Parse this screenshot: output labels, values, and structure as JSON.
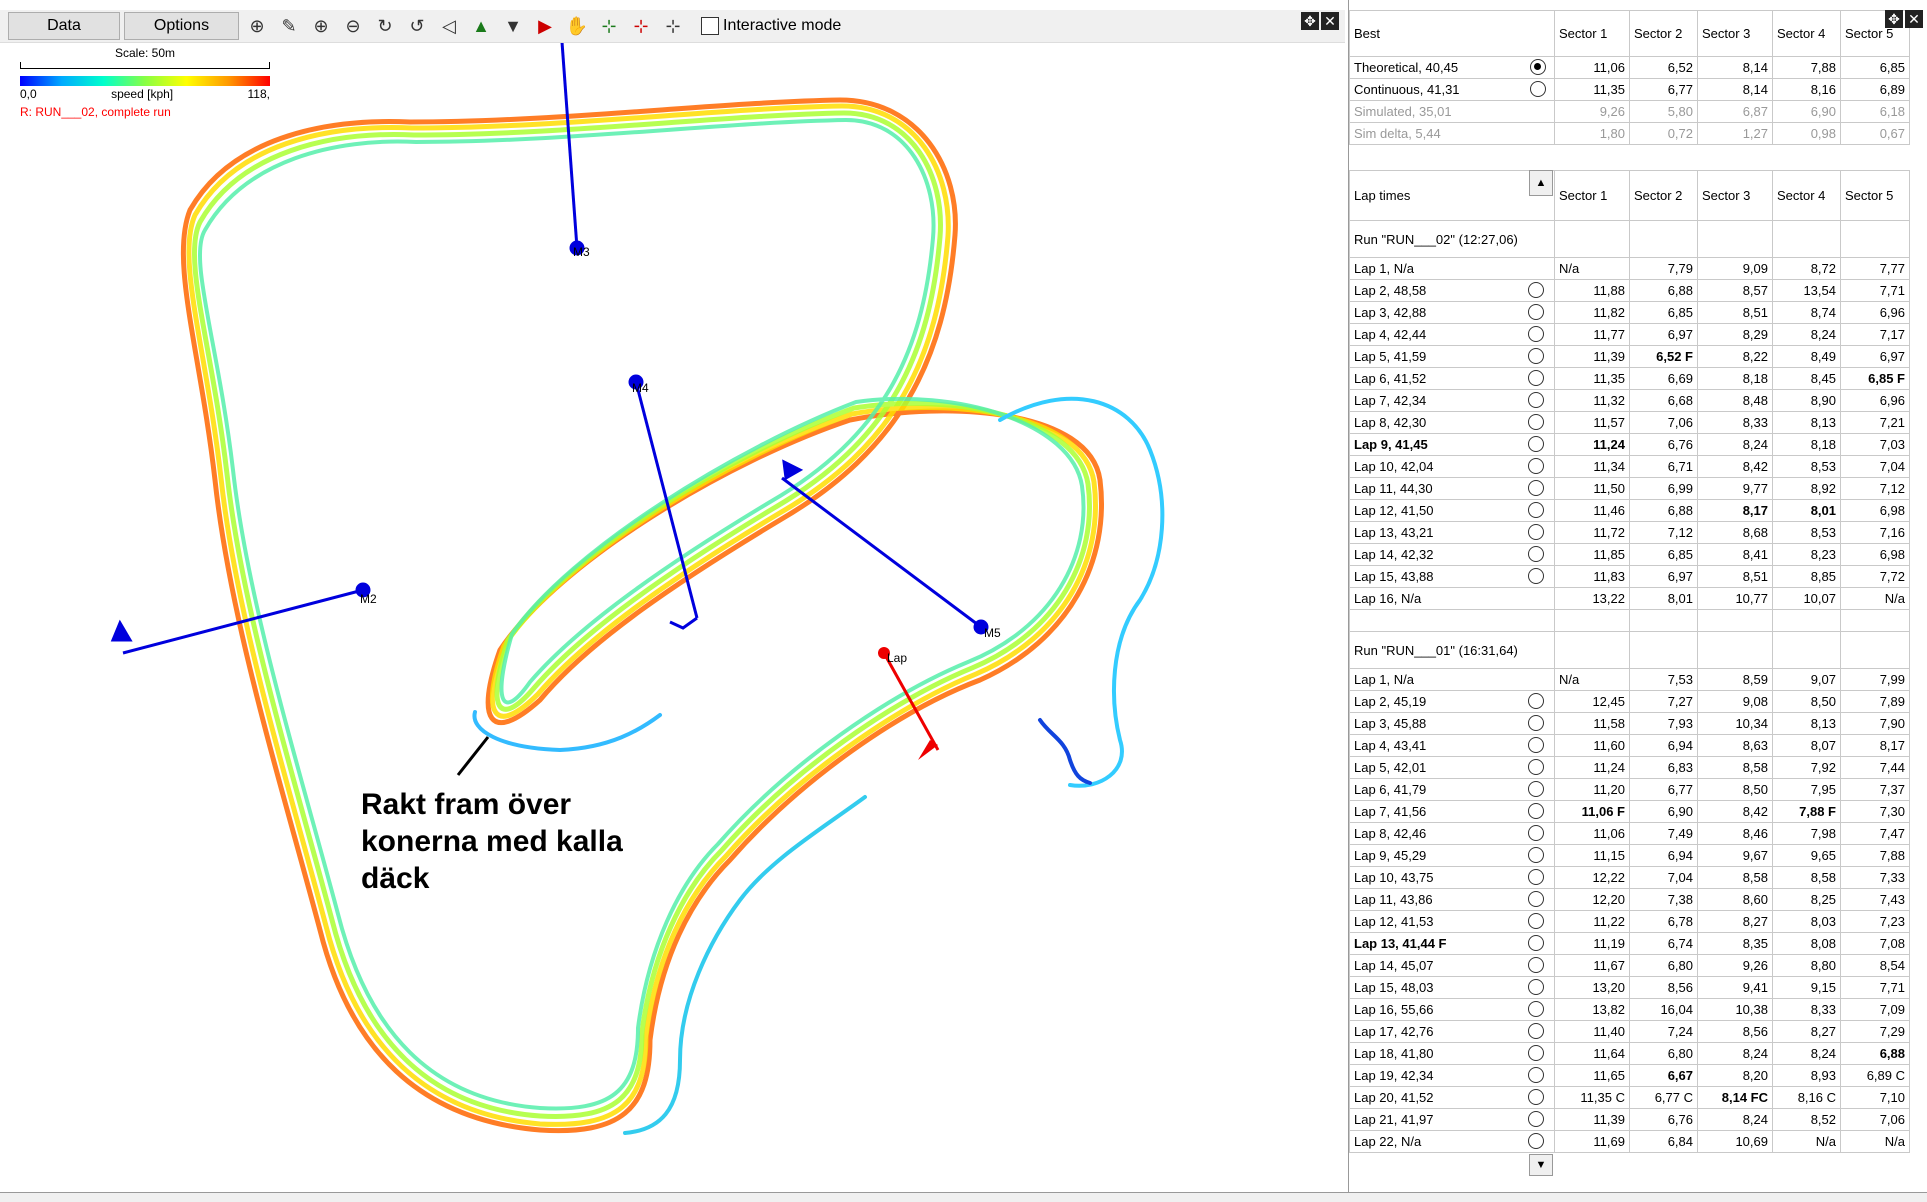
{
  "toolbar": {
    "data_label": "Data",
    "options_label": "Options",
    "interactive_label": "Interactive mode",
    "icons": [
      "zoom-fit-icon",
      "edit-icon",
      "zoom-in-icon",
      "zoom-out-icon",
      "rotate-cw-icon",
      "rotate-ccw-icon",
      "prev-marker-icon",
      "start-marker-icon",
      "split-marker-icon",
      "end-marker-icon",
      "pan-hand-icon",
      "add-point-icon",
      "remove-point-icon",
      "reset-points-icon"
    ]
  },
  "map": {
    "scale_label": "Scale: 50m",
    "speed_min": "0,0",
    "speed_label": "speed [kph]",
    "speed_max": "118,",
    "run_label": "R:  RUN___02, complete run",
    "markers": [
      "M2",
      "M3",
      "M4",
      "M5",
      "Lap"
    ],
    "annotation": "Rakt fram över konerna med kalla däck"
  },
  "best": {
    "headers": [
      "Best",
      "Sector 1",
      "Sector 2",
      "Sector 3",
      "Sector 4",
      "Sector 5"
    ],
    "rows": [
      {
        "label": "Theoretical,  40,45",
        "radio": "on",
        "vals": [
          "11,06",
          "6,52",
          "8,14",
          "7,88",
          "6,85"
        ]
      },
      {
        "label": "Continuous, 41,31",
        "radio": "off",
        "vals": [
          "11,35",
          "6,77",
          "8,14",
          "8,16",
          "6,89"
        ]
      },
      {
        "label": "Simulated, 35,01",
        "radio": "",
        "grey": true,
        "vals": [
          "9,26",
          "5,80",
          "6,87",
          "6,90",
          "6,18"
        ]
      },
      {
        "label": "Sim delta, 5,44",
        "radio": "",
        "grey": true,
        "vals": [
          "1,80",
          "0,72",
          "1,27",
          "0,98",
          "0,67"
        ]
      }
    ]
  },
  "laps": {
    "headers": [
      "Lap times",
      "Sector 1",
      "Sector 2",
      "Sector 3",
      "Sector 4",
      "Sector 5"
    ],
    "groups": [
      {
        "title": "Run \"RUN___02\" (12:27,06)",
        "rows": [
          {
            "label": "Lap 1, N/a",
            "radio": false,
            "vals": [
              "N/a",
              "7,79",
              "9,09",
              "8,72",
              "7,77"
            ]
          },
          {
            "label": "Lap 2, 48,58",
            "radio": true,
            "vals": [
              "11,88",
              "6,88",
              "8,57",
              "13,54",
              "7,71"
            ]
          },
          {
            "label": "Lap 3, 42,88",
            "radio": true,
            "vals": [
              "11,82",
              "6,85",
              "8,51",
              "8,74",
              "6,96"
            ]
          },
          {
            "label": "Lap 4, 42,44",
            "radio": true,
            "vals": [
              "11,77",
              "6,97",
              "8,29",
              "8,24",
              "7,17"
            ]
          },
          {
            "label": "Lap 5, 41,59",
            "radio": true,
            "vals": [
              "11,39",
              "6,52 F",
              "8,22",
              "8,49",
              "6,97"
            ],
            "bold_cols": [
              1
            ]
          },
          {
            "label": "Lap 6, 41,52",
            "radio": true,
            "vals": [
              "11,35",
              "6,69",
              "8,18",
              "8,45",
              "6,85 F"
            ],
            "bold_cols": [
              4
            ]
          },
          {
            "label": "Lap 7, 42,34",
            "radio": true,
            "vals": [
              "11,32",
              "6,68",
              "8,48",
              "8,90",
              "6,96"
            ]
          },
          {
            "label": "Lap 8, 42,30",
            "radio": true,
            "vals": [
              "11,57",
              "7,06",
              "8,33",
              "8,13",
              "7,21"
            ]
          },
          {
            "label": "Lap 9, 41,45",
            "radio": true,
            "bold_label": true,
            "vals": [
              "11,24",
              "6,76",
              "8,24",
              "8,18",
              "7,03"
            ],
            "bold_cols": [
              0
            ]
          },
          {
            "label": "Lap 10, 42,04",
            "radio": true,
            "vals": [
              "11,34",
              "6,71",
              "8,42",
              "8,53",
              "7,04"
            ]
          },
          {
            "label": "Lap 11, 44,30",
            "radio": true,
            "vals": [
              "11,50",
              "6,99",
              "9,77",
              "8,92",
              "7,12"
            ]
          },
          {
            "label": "Lap 12, 41,50",
            "radio": true,
            "vals": [
              "11,46",
              "6,88",
              "8,17",
              "8,01",
              "6,98"
            ],
            "bold_cols": [
              2,
              3
            ]
          },
          {
            "label": "Lap 13, 43,21",
            "radio": true,
            "vals": [
              "11,72",
              "7,12",
              "8,68",
              "8,53",
              "7,16"
            ]
          },
          {
            "label": "Lap 14, 42,32",
            "radio": true,
            "vals": [
              "11,85",
              "6,85",
              "8,41",
              "8,23",
              "6,98"
            ]
          },
          {
            "label": "Lap 15, 43,88",
            "radio": true,
            "vals": [
              "11,83",
              "6,97",
              "8,51",
              "8,85",
              "7,72"
            ]
          },
          {
            "label": "Lap 16, N/a",
            "radio": false,
            "vals": [
              "13,22",
              "8,01",
              "10,77",
              "10,07",
              "N/a"
            ]
          }
        ]
      },
      {
        "title": "Run \"RUN___01\" (16:31,64)",
        "rows": [
          {
            "label": "Lap 1, N/a",
            "radio": false,
            "vals": [
              "N/a",
              "7,53",
              "8,59",
              "9,07",
              "7,99"
            ]
          },
          {
            "label": "Lap 2, 45,19",
            "radio": true,
            "vals": [
              "12,45",
              "7,27",
              "9,08",
              "8,50",
              "7,89"
            ]
          },
          {
            "label": "Lap 3, 45,88",
            "radio": true,
            "vals": [
              "11,58",
              "7,93",
              "10,34",
              "8,13",
              "7,90"
            ]
          },
          {
            "label": "Lap 4, 43,41",
            "radio": true,
            "vals": [
              "11,60",
              "6,94",
              "8,63",
              "8,07",
              "8,17"
            ]
          },
          {
            "label": "Lap 5, 42,01",
            "radio": true,
            "vals": [
              "11,24",
              "6,83",
              "8,58",
              "7,92",
              "7,44"
            ]
          },
          {
            "label": "Lap 6, 41,79",
            "radio": true,
            "vals": [
              "11,20",
              "6,77",
              "8,50",
              "7,95",
              "7,37"
            ]
          },
          {
            "label": "Lap 7, 41,56",
            "radio": true,
            "vals": [
              "11,06 F",
              "6,90",
              "8,42",
              "7,88 F",
              "7,30"
            ],
            "bold_cols": [
              0,
              3
            ]
          },
          {
            "label": "Lap 8, 42,46",
            "radio": true,
            "vals": [
              "11,06",
              "7,49",
              "8,46",
              "7,98",
              "7,47"
            ]
          },
          {
            "label": "Lap 9, 45,29",
            "radio": true,
            "vals": [
              "11,15",
              "6,94",
              "9,67",
              "9,65",
              "7,88"
            ]
          },
          {
            "label": "Lap 10, 43,75",
            "radio": true,
            "vals": [
              "12,22",
              "7,04",
              "8,58",
              "8,58",
              "7,33"
            ]
          },
          {
            "label": "Lap 11, 43,86",
            "radio": true,
            "vals": [
              "12,20",
              "7,38",
              "8,60",
              "8,25",
              "7,43"
            ]
          },
          {
            "label": "Lap 12, 41,53",
            "radio": true,
            "vals": [
              "11,22",
              "6,78",
              "8,27",
              "8,03",
              "7,23"
            ]
          },
          {
            "label": "Lap 13, 41,44 F",
            "radio": true,
            "bold_label": true,
            "vals": [
              "11,19",
              "6,74",
              "8,35",
              "8,08",
              "7,08"
            ]
          },
          {
            "label": "Lap 14, 45,07",
            "radio": true,
            "vals": [
              "11,67",
              "6,80",
              "9,26",
              "8,80",
              "8,54"
            ]
          },
          {
            "label": "Lap 15, 48,03",
            "radio": true,
            "vals": [
              "13,20",
              "8,56",
              "9,41",
              "9,15",
              "7,71"
            ]
          },
          {
            "label": "Lap 16, 55,66",
            "radio": true,
            "vals": [
              "13,82",
              "16,04",
              "10,38",
              "8,33",
              "7,09"
            ]
          },
          {
            "label": "Lap 17, 42,76",
            "radio": true,
            "vals": [
              "11,40",
              "7,24",
              "8,56",
              "8,27",
              "7,29"
            ]
          },
          {
            "label": "Lap 18, 41,80",
            "radio": true,
            "vals": [
              "11,64",
              "6,80",
              "8,24",
              "8,24",
              "6,88"
            ],
            "bold_cols": [
              4
            ]
          },
          {
            "label": "Lap 19, 42,34",
            "radio": true,
            "vals": [
              "11,65",
              "6,67",
              "8,20",
              "8,93",
              "6,89 C"
            ],
            "bold_cols": [
              1
            ]
          },
          {
            "label": "Lap 20, 41,52",
            "radio": true,
            "vals": [
              "11,35 C",
              "6,77 C",
              "8,14 FC",
              "8,16 C",
              "7,10"
            ],
            "bold_cols": [
              2
            ]
          },
          {
            "label": "Lap 21, 41,97",
            "radio": true,
            "vals": [
              "11,39",
              "6,76",
              "8,24",
              "8,52",
              "7,06"
            ]
          },
          {
            "label": "Lap 22, N/a",
            "radio": true,
            "vals": [
              "11,69",
              "6,84",
              "10,69",
              "N/a",
              "N/a"
            ]
          }
        ]
      }
    ]
  }
}
